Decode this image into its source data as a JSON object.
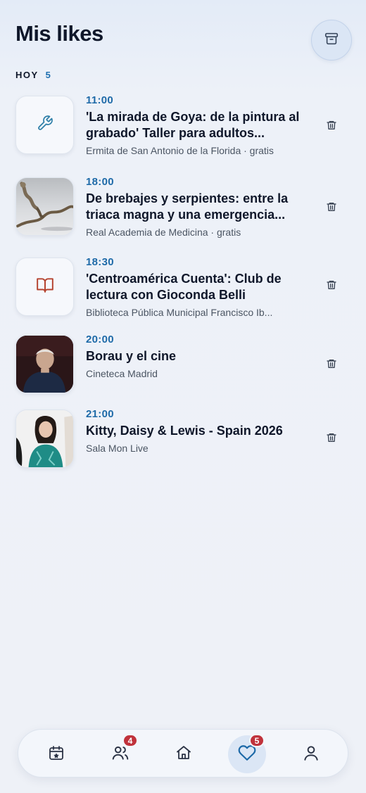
{
  "header": {
    "title": "Mis likes"
  },
  "section": {
    "label": "HOY",
    "count": "5"
  },
  "items": [
    {
      "time": "11:00",
      "title": "'La mirada de Goya: de la pintura al grabado' Taller para adultos...",
      "venue": "Ermita de San Antonio de la Florida · gratis",
      "thumb": "wrench-icon"
    },
    {
      "time": "18:00",
      "title": "De brebajes y serpientes: entre la triaca magna y una emergencia...",
      "venue": "Real Academia de Medicina · gratis",
      "thumb": "photo-serpent-sculpture"
    },
    {
      "time": "18:30",
      "title": "'Centroamérica Cuenta': Club de lectura con Gioconda Belli",
      "venue": "Biblioteca Pública Municipal Francisco Ib...",
      "thumb": "book-icon"
    },
    {
      "time": "20:00",
      "title": "Borau y el cine",
      "venue": "Cineteca Madrid",
      "thumb": "photo-elderly-man"
    },
    {
      "time": "21:00",
      "title": "Kitty, Daisy & Lewis - Spain 2026",
      "venue": "Sala Mon Live",
      "thumb": "photo-singer"
    }
  ],
  "nav": {
    "people_badge": "4",
    "likes_badge": "5"
  },
  "colors": {
    "accent": "#1e6aa8",
    "badge": "#c0323b",
    "wrench": "#2f7fa8",
    "book": "#b5432f"
  }
}
